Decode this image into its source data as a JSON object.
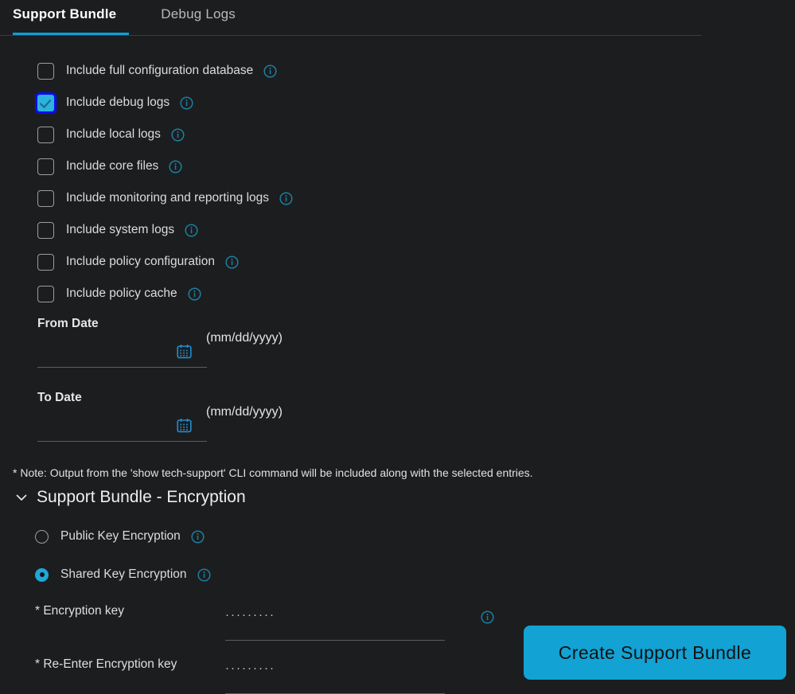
{
  "tabs": [
    {
      "label": "Support Bundle",
      "active": true
    },
    {
      "label": "Debug Logs",
      "active": false
    }
  ],
  "colors": {
    "background": "#1c1d1f",
    "accent": "#0d9fd8",
    "checkbox_checked_fill": "#2bb2dd",
    "checkbox_focus_ring": "#0b0bf4",
    "info_icon": "#1b7fa0",
    "button": "#12a2d3",
    "button_text": "#101214",
    "text": "#dcdcdc",
    "divider": "#3a3c3f"
  },
  "checkboxes": [
    {
      "label": "Include full configuration database",
      "checked": false,
      "info_icon": "info-icon"
    },
    {
      "label": "Include debug logs",
      "checked": true,
      "info_icon": "info-icon"
    },
    {
      "label": "Include local logs",
      "checked": false,
      "info_icon": "info-icon"
    },
    {
      "label": "Include core files",
      "checked": false,
      "info_icon": "info-icon"
    },
    {
      "label": "Include monitoring and reporting logs",
      "checked": false,
      "info_icon": "info-icon"
    },
    {
      "label": "Include system logs",
      "checked": false,
      "info_icon": "info-icon"
    },
    {
      "label": "Include policy configuration",
      "checked": false,
      "info_icon": "info-icon"
    },
    {
      "label": "Include policy cache",
      "checked": false,
      "info_icon": "info-icon"
    }
  ],
  "dates": {
    "from": {
      "label": "From Date",
      "value": "",
      "placeholder": "",
      "format_hint": "(mm/dd/yyyy)",
      "icon": "calendar-icon"
    },
    "to": {
      "label": "To Date",
      "value": "",
      "placeholder": "",
      "format_hint": "(mm/dd/yyyy)",
      "icon": "calendar-icon"
    }
  },
  "note": "* Note: Output from the 'show tech-support' CLI command will be included along with the selected entries.",
  "encryption": {
    "section_title": "Support Bundle - Encryption",
    "collapse_icon": "chevron-down-icon",
    "expanded": true,
    "options": [
      {
        "label": "Public Key Encryption",
        "selected": false,
        "info_icon": "info-icon"
      },
      {
        "label": "Shared Key Encryption",
        "selected": true,
        "info_icon": "info-icon"
      }
    ],
    "fields": [
      {
        "label": "* Encryption key",
        "value": "·········",
        "masked": true,
        "has_info": true,
        "info_icon": "info-icon"
      },
      {
        "label": "* Re-Enter Encryption key",
        "value": "·········",
        "masked": true,
        "has_info": false
      }
    ]
  },
  "actions": {
    "create_bundle_label": "Create Support Bundle"
  }
}
